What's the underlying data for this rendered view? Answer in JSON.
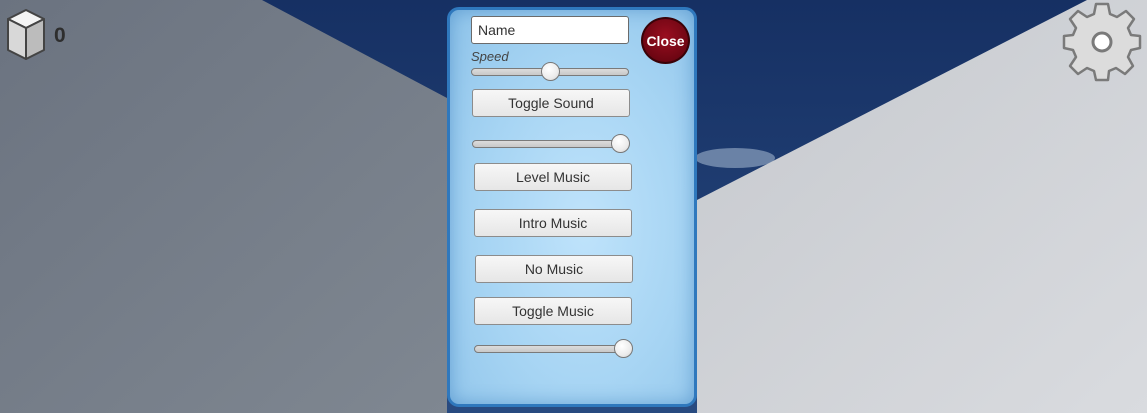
{
  "hud": {
    "cube_icon": "cube-icon",
    "cube_count": "0",
    "settings_icon": "gear-icon"
  },
  "panel": {
    "name_placeholder": "Name",
    "close_label": "Close",
    "speed_label": "Speed",
    "speed_value": 0.5,
    "toggle_sound_label": "Toggle Sound",
    "sound_volume": 1.0,
    "level_music_label": "Level Music",
    "intro_music_label": "Intro Music",
    "no_music_label": "No Music",
    "toggle_music_label": "Toggle Music",
    "music_volume": 1.0
  },
  "colors": {
    "panel_border": "#2f78bd",
    "panel_fill": "#a6d4f3",
    "close_button": "#7a0a18",
    "sky": "#1e3a6e"
  }
}
